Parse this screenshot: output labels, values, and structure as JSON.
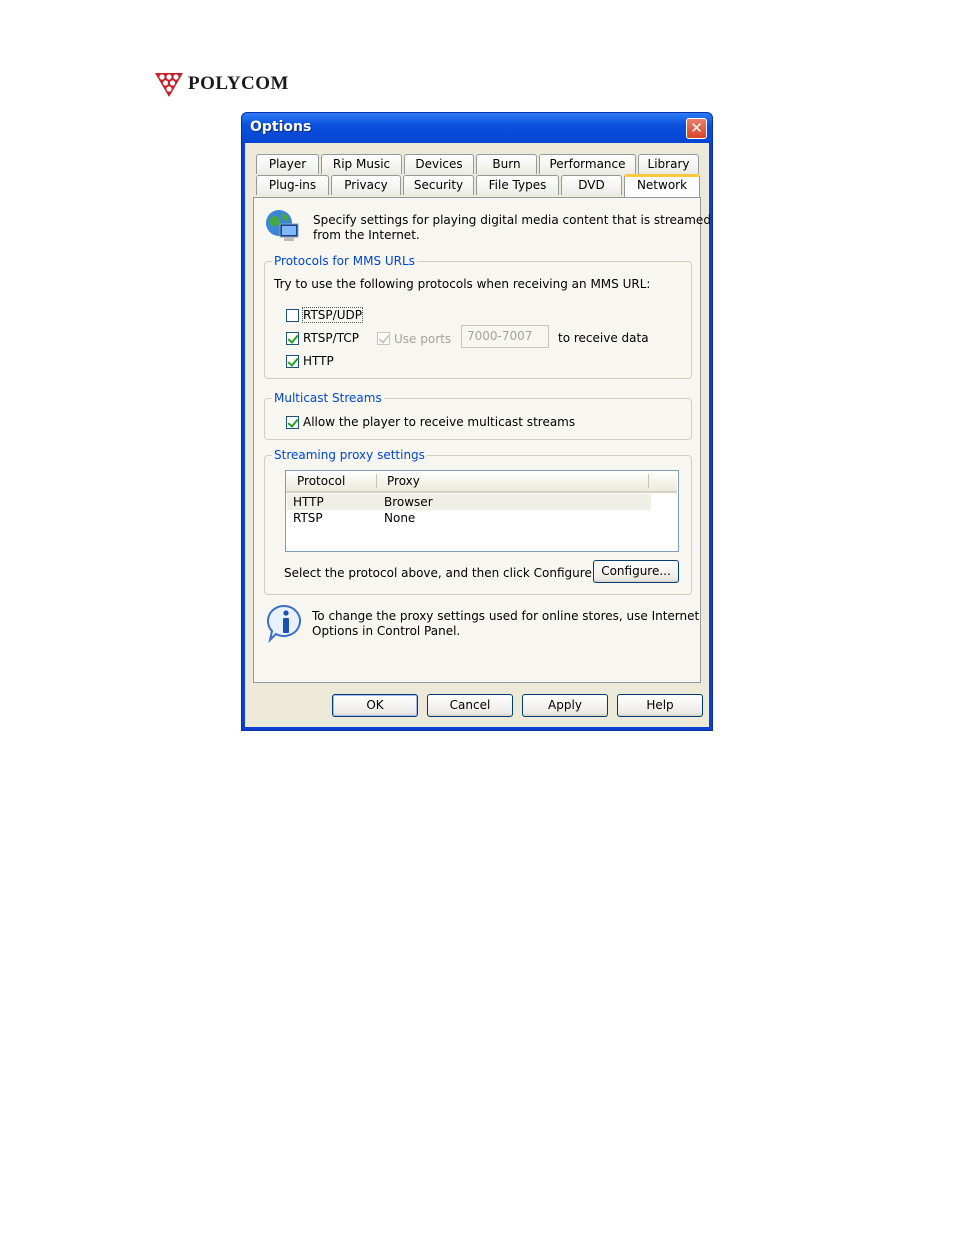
{
  "logo": {
    "text": "POLYCOM",
    "icon": "polycom-triangle-logo"
  },
  "window": {
    "title": "Options",
    "close_icon": "close-icon"
  },
  "tabs": {
    "row1": [
      "Player",
      "Rip Music",
      "Devices",
      "Burn",
      "Performance",
      "Library"
    ],
    "row2": [
      "Plug-ins",
      "Privacy",
      "Security",
      "File Types",
      "DVD",
      "Network"
    ],
    "active": "Network"
  },
  "intro": {
    "icon": "globe-computer-icon",
    "line1": "Specify settings for playing digital media content that is streamed",
    "line2": "from the Internet."
  },
  "protocols": {
    "label": "Protocols for MMS URLs",
    "description": "Try to use the following protocols when receiving an MMS URL:",
    "rtsp_udp": {
      "label": "RTSP/UDP",
      "checked": false
    },
    "rtsp_tcp": {
      "label": "RTSP/TCP",
      "checked": true
    },
    "http": {
      "label": "HTTP",
      "checked": true
    },
    "use_ports": {
      "label": "Use ports",
      "checked": true,
      "enabled": false
    },
    "ports_value": "7000-7007",
    "receive_label": "to receive data"
  },
  "multicast": {
    "label": "Multicast Streams",
    "allow": {
      "label": "Allow the player to receive multicast streams",
      "checked": true
    }
  },
  "proxy": {
    "label": "Streaming proxy settings",
    "columns": [
      "Protocol",
      "Proxy"
    ],
    "rows": [
      {
        "protocol": "HTTP",
        "proxy": "Browser"
      },
      {
        "protocol": "RTSP",
        "proxy": "None"
      }
    ],
    "hint": "Select the protocol above, and then click Configure.",
    "configure_label": "Configure..."
  },
  "info": {
    "icon": "info-icon",
    "line1": "To change the proxy settings used for online stores, use Internet",
    "line2": "Options in Control Panel."
  },
  "buttons": {
    "ok": "OK",
    "cancel": "Cancel",
    "apply": "Apply",
    "help": "Help"
  }
}
